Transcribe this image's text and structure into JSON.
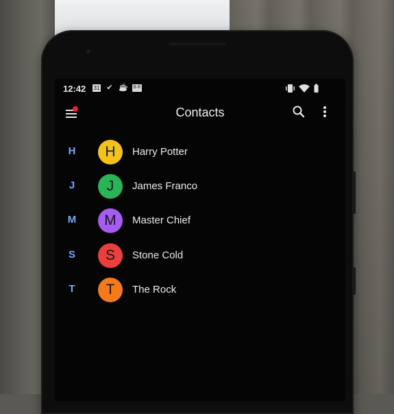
{
  "status_bar": {
    "time": "12:42",
    "icons": [
      {
        "name": "calendar-icon",
        "text": "31"
      },
      {
        "name": "task-check-icon",
        "text": "✔"
      },
      {
        "name": "cup-icon",
        "text": "☕"
      },
      {
        "name": "br-badge-icon",
        "text": "B·R"
      }
    ],
    "right_icons": [
      "vibrate-icon",
      "wifi-icon",
      "battery-icon"
    ]
  },
  "app_bar": {
    "title": "Contacts",
    "menu_icon": "hamburger-menu-icon",
    "search_icon": "search-icon",
    "more_icon": "more-vertical-icon",
    "notification_color": "#e8262d"
  },
  "contacts": [
    {
      "section": "H",
      "initial": "H",
      "name": "Harry Potter",
      "color": "#f4c21b"
    },
    {
      "section": "J",
      "initial": "J",
      "name": "James Franco",
      "color": "#2bb457"
    },
    {
      "section": "M",
      "initial": "M",
      "name": "Master Chief",
      "color": "#a75cf1"
    },
    {
      "section": "S",
      "initial": "S",
      "name": "Stone Cold",
      "color": "#ea3f3c"
    },
    {
      "section": "T",
      "initial": "T",
      "name": "The Rock",
      "color": "#f57a1c"
    }
  ],
  "colors": {
    "section_letter": "#7aa6f2",
    "screen_background": "#050505",
    "text_primary": "#ececec"
  }
}
